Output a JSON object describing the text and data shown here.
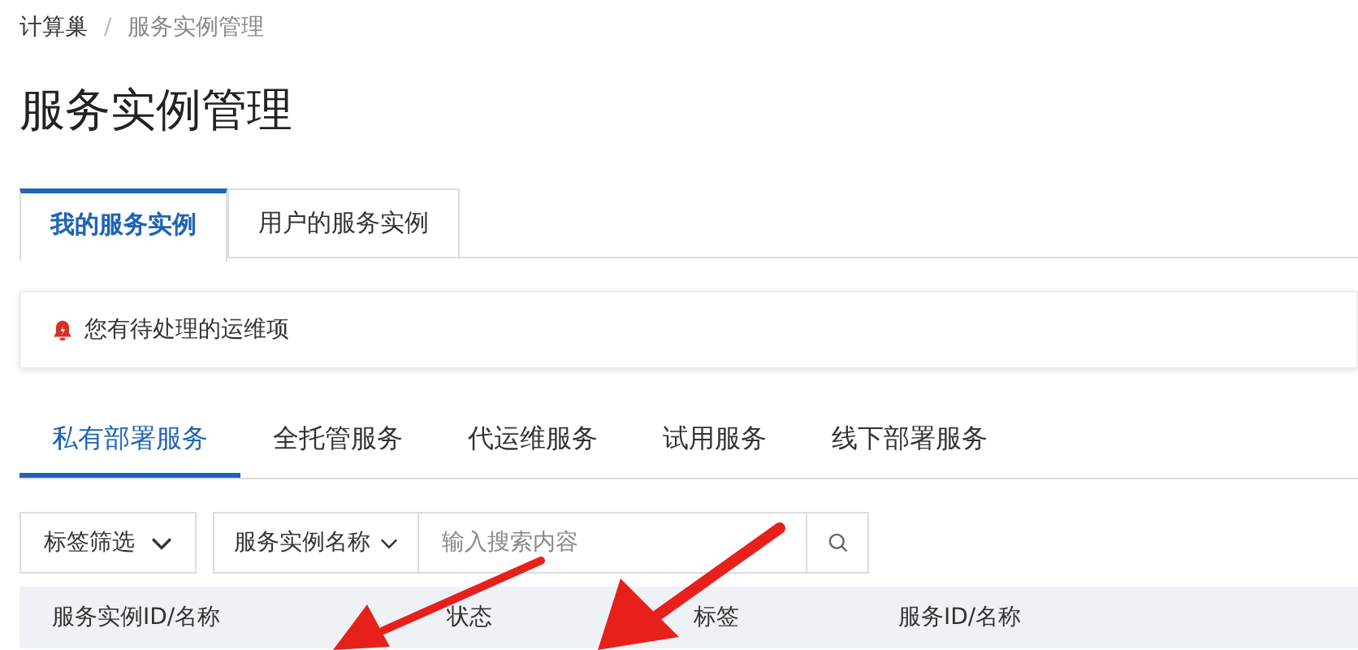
{
  "breadcrumb": [
    "计算巢",
    "服务实例管理"
  ],
  "breadcrumb_separator": "/",
  "title": "服务实例管理",
  "tabs": [
    {
      "label": "我的服务实例",
      "selected": true
    },
    {
      "label": "用户的服务实例",
      "selected": false
    }
  ],
  "alert": {
    "text": "您有待处理的运维项"
  },
  "subtabs": [
    {
      "label": "私有部署服务",
      "selected": true
    },
    {
      "label": "全托管服务",
      "selected": false
    },
    {
      "label": "代运维服务",
      "selected": false
    },
    {
      "label": "试用服务",
      "selected": false
    },
    {
      "label": "线下部署服务",
      "selected": false
    }
  ],
  "filters": {
    "tag_filter": "标签筛选",
    "field_select": "服务实例名称",
    "search": {
      "placeholder": "输入搜索内容"
    }
  },
  "table": {
    "columns": [
      "服务实例ID/名称",
      "状态",
      "标签",
      "服务ID/名称"
    ]
  }
}
